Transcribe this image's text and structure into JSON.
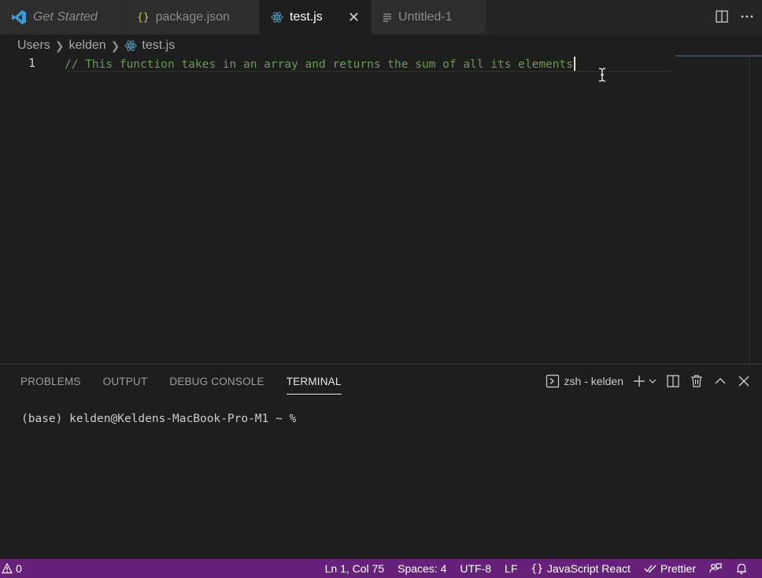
{
  "tabs": [
    {
      "label": "Get Started"
    },
    {
      "label": "package.json",
      "icon": "{}"
    },
    {
      "label": "test.js",
      "close": "✕"
    },
    {
      "label": "Untitled-1"
    }
  ],
  "breadcrumb": {
    "items": [
      "Users",
      "kelden",
      "test.js"
    ]
  },
  "editor": {
    "line_number": "1",
    "code": "// This function takes in an array and returns the sum of all its elements"
  },
  "panel": {
    "tabs": [
      "PROBLEMS",
      "OUTPUT",
      "DEBUG CONSOLE",
      "TERMINAL"
    ],
    "terminal_name": "zsh - kelden",
    "terminal_line": "(base) kelden@Keldens-MacBook-Pro-M1 ~ % "
  },
  "statusbar": {
    "problems": "0",
    "position": "Ln 1, Col 75",
    "spaces": "Spaces: 4",
    "encoding": "UTF-8",
    "eol": "LF",
    "language": "JavaScript React",
    "prettier": "Prettier"
  },
  "colors": {
    "statusbar": "#68217a",
    "comment": "#6a9955",
    "react_icon": "#519aba",
    "vscode_logo": "#3c99d4"
  }
}
